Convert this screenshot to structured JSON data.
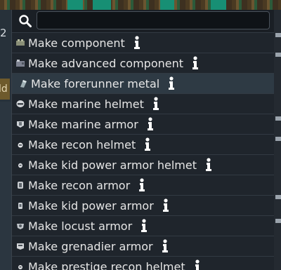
{
  "left_panel": {
    "number": "2",
    "tab_label": "ld"
  },
  "search": {
    "value": "",
    "placeholder": ""
  },
  "recipes": [
    {
      "label": "Make component",
      "icon": "component-icon"
    },
    {
      "label": "Make advanced component",
      "icon": "advanced-component-icon"
    },
    {
      "label": "Make forerunner metal",
      "icon": "forerunner-metal-icon"
    },
    {
      "label": "Make marine helmet",
      "icon": "marine-helmet-icon"
    },
    {
      "label": "Make marine armor",
      "icon": "marine-armor-icon"
    },
    {
      "label": "Make recon helmet",
      "icon": "recon-helmet-icon"
    },
    {
      "label": "Make kid power armor helmet",
      "icon": "kid-power-armor-helmet-icon"
    },
    {
      "label": "Make recon armor",
      "icon": "recon-armor-icon"
    },
    {
      "label": "Make kid power armor",
      "icon": "kid-power-armor-icon"
    },
    {
      "label": "Make locust armor",
      "icon": "locust-armor-icon"
    },
    {
      "label": "Make grenadier armor",
      "icon": "grenadier-armor-icon"
    },
    {
      "label": "Make prestige recon helmet",
      "icon": "prestige-recon-helmet-icon"
    }
  ],
  "selected_index": 2,
  "colors": {
    "panel": "#1f252c",
    "selected_row": "#2e3a44",
    "text": "#e6e6e6",
    "accent": "#178f74"
  }
}
